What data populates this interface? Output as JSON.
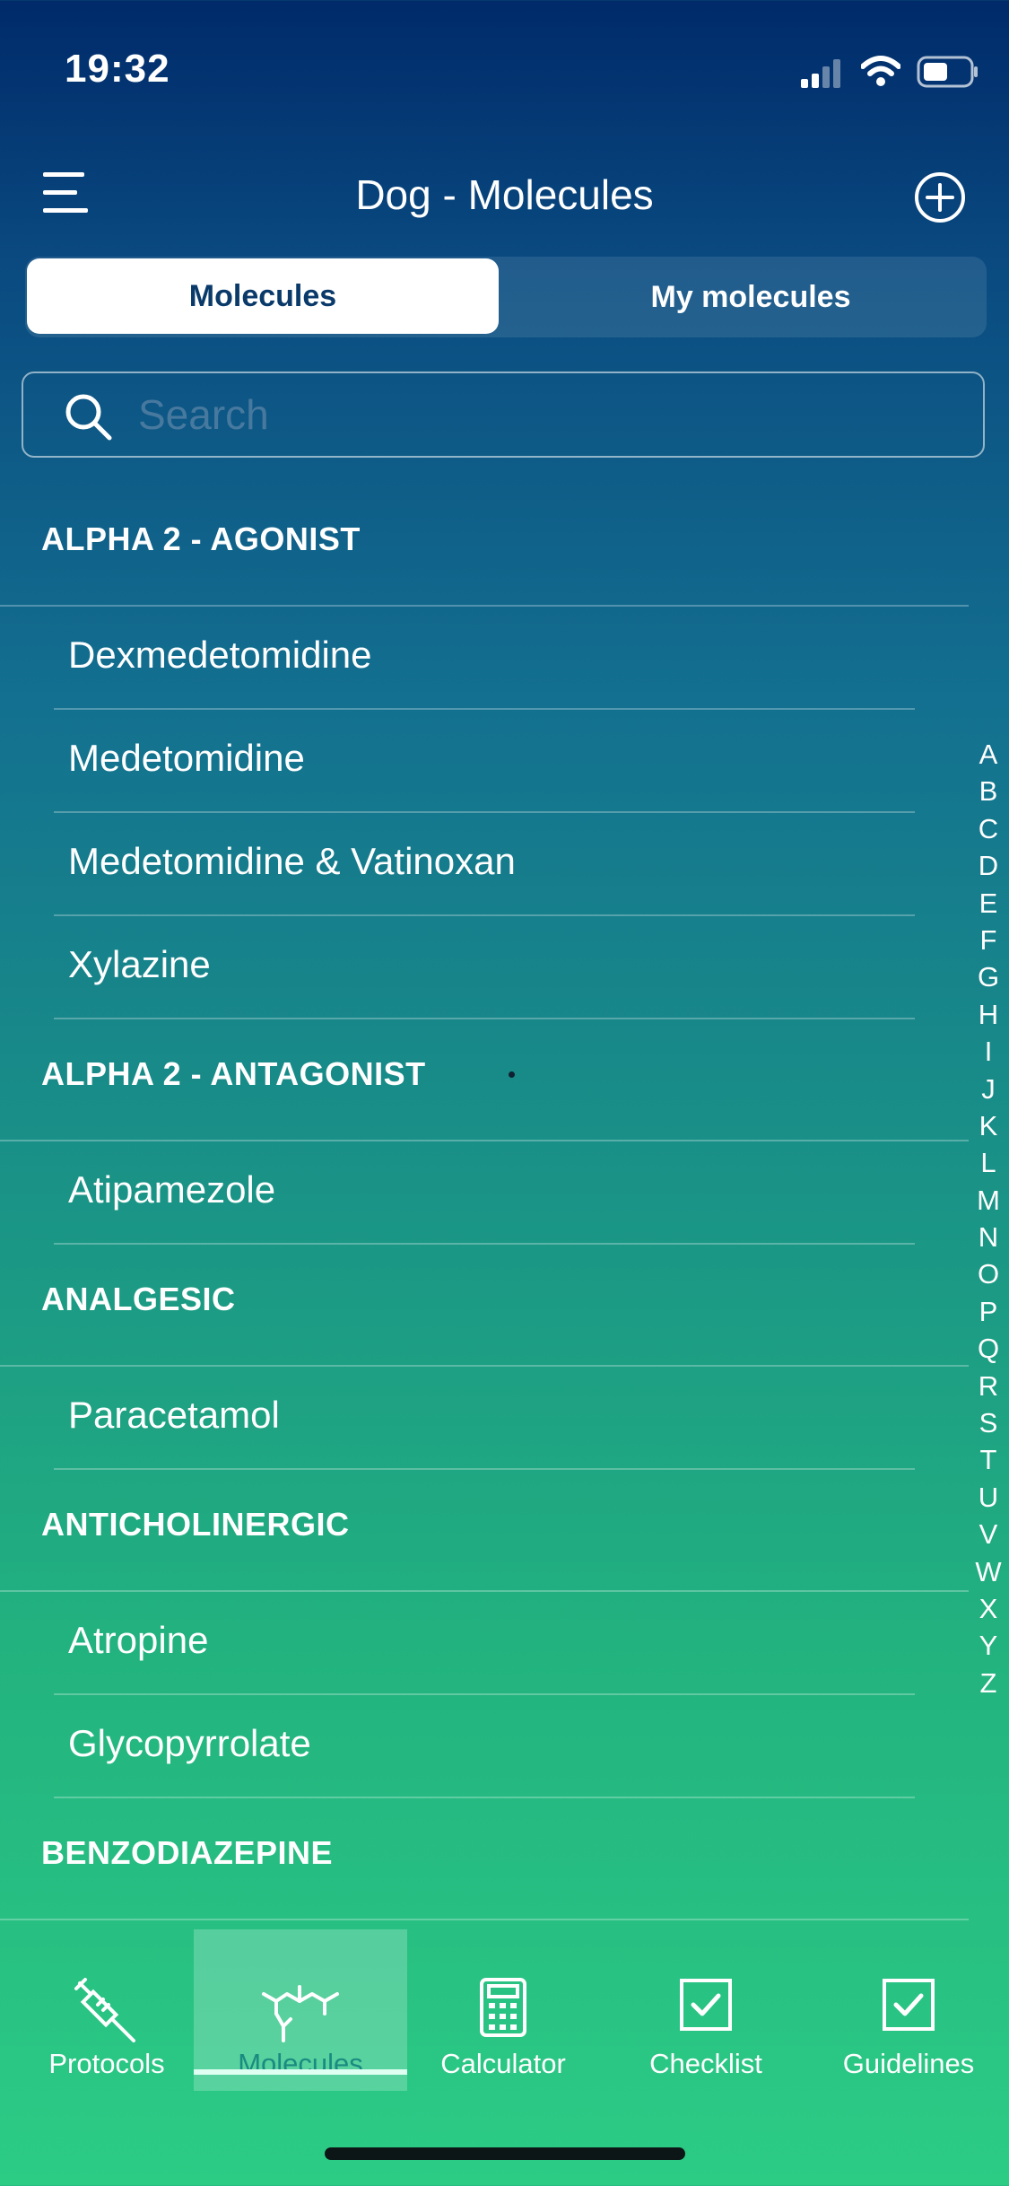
{
  "status_bar": {
    "time": "19:32"
  },
  "header": {
    "title": "Dog - Molecules"
  },
  "segmented": {
    "tabs": [
      "Molecules",
      "My molecules"
    ],
    "active": "Molecules"
  },
  "search": {
    "placeholder": "Search",
    "value": ""
  },
  "sections": [
    {
      "title": "ALPHA 2 - AGONIST",
      "items": [
        "Dexmedetomidine",
        "Medetomidine",
        "Medetomidine & Vatinoxan",
        "Xylazine"
      ]
    },
    {
      "title": "ALPHA 2 - ANTAGONIST",
      "items": [
        "Atipamezole"
      ]
    },
    {
      "title": "ANALGESIC",
      "items": [
        "Paracetamol"
      ]
    },
    {
      "title": "ANTICHOLINERGIC",
      "items": [
        "Atropine",
        "Glycopyrrolate"
      ]
    },
    {
      "title": "BENZODIAZEPINE",
      "items": []
    }
  ],
  "index_letters": [
    "A",
    "B",
    "C",
    "D",
    "E",
    "F",
    "G",
    "H",
    "I",
    "J",
    "K",
    "L",
    "M",
    "N",
    "O",
    "P",
    "Q",
    "R",
    "S",
    "T",
    "U",
    "V",
    "W",
    "X",
    "Y",
    "Z"
  ],
  "tab_bar": {
    "tabs": [
      {
        "label": "Protocols",
        "icon": "syringe-icon"
      },
      {
        "label": "Molecules",
        "icon": "molecule-icon"
      },
      {
        "label": "Calculator",
        "icon": "calculator-icon"
      },
      {
        "label": "Checklist",
        "icon": "checkbox-icon"
      },
      {
        "label": "Guidelines",
        "icon": "checkbox-icon"
      }
    ],
    "active": "Molecules"
  },
  "colors": {
    "accent_active_tab_label": "#1b8a80",
    "segment_active_text": "#0a3a6a"
  }
}
